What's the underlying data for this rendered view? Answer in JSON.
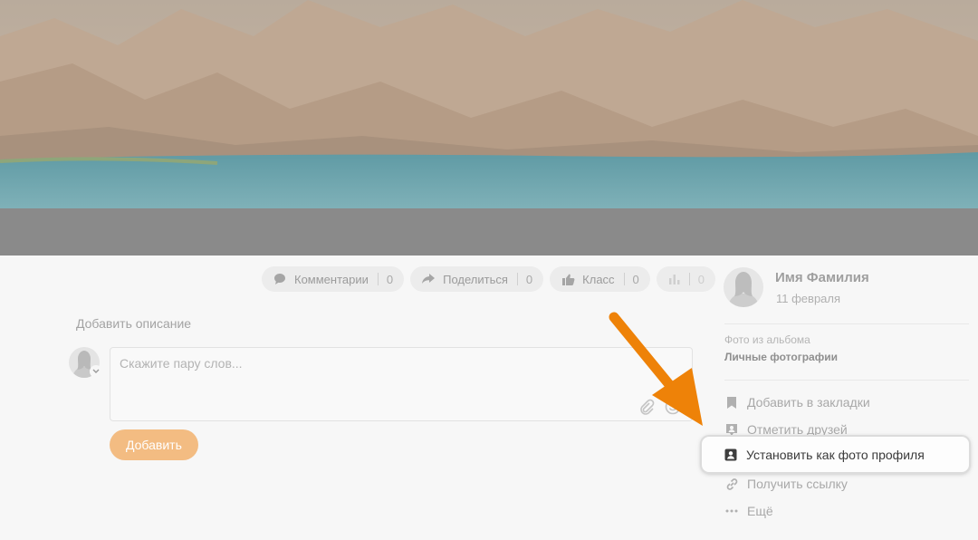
{
  "photo_actions": {
    "comments": {
      "label": "Комментарии",
      "count": "0",
      "icon": "comment-icon"
    },
    "share": {
      "label": "Поделиться",
      "count": "0",
      "icon": "share-arrow-icon"
    },
    "like": {
      "label": "Класс",
      "count": "0",
      "icon": "thumbs-up-icon"
    },
    "stats": {
      "count": "0",
      "icon": "bar-chart-icon"
    }
  },
  "description": {
    "add_label": "Добавить описание"
  },
  "comment": {
    "placeholder": "Скажите пару слов...",
    "submit_label": "Добавить"
  },
  "author": {
    "name": "Имя Фамилия",
    "date": "11 февраля"
  },
  "album": {
    "label": "Фото из альбома",
    "name": "Личные фотографии"
  },
  "menu": {
    "bookmark": "Добавить в закладки",
    "tag_friends": "Отметить друзей",
    "set_profile_photo": "Установить как фото профиля",
    "get_link": "Получить ссылку",
    "more": "Ещё"
  },
  "colors": {
    "accent_orange": "#ee8208",
    "button_orange": "#f3bc82"
  }
}
